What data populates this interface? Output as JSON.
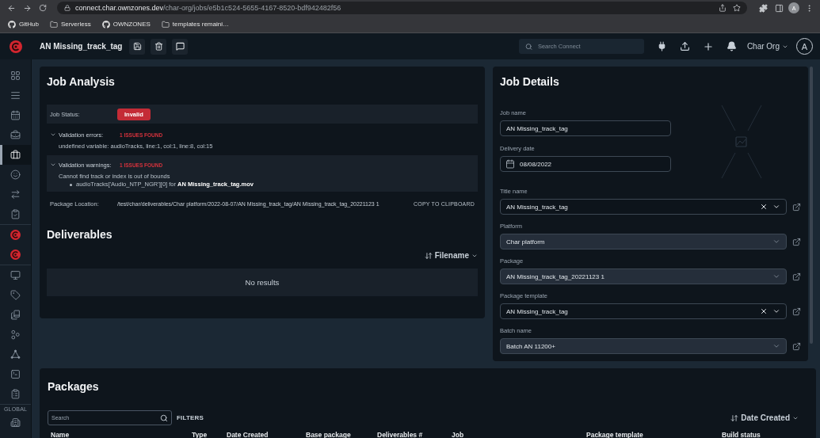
{
  "browser": {
    "url_host": "connect.char.ownzones.dev",
    "url_path": "/char-org/jobs/e5b1c524-5655-4167-8520-bdf942482f56",
    "profile": "A",
    "bookmarks": [
      {
        "label": "GitHub",
        "kind": "repo"
      },
      {
        "label": "Serverless",
        "kind": "folder"
      },
      {
        "label": "OWNZONES",
        "kind": "repo"
      },
      {
        "label": "templates remaini…",
        "kind": "folder"
      }
    ]
  },
  "header": {
    "title": "AN Missing_track_tag",
    "search_placeholder": "Search Connect",
    "org": "Char Org",
    "avatar": "A"
  },
  "sidebar": {
    "groups": [
      {
        "items": [
          {
            "selected": false
          },
          {
            "selected": false
          },
          {
            "selected": false
          },
          {
            "selected": false
          },
          {
            "selected": true
          },
          {
            "selected": false
          },
          {
            "selected": false
          },
          {
            "selected": false
          }
        ]
      },
      {
        "items": [
          {
            "selected": false
          },
          {
            "selected": false
          }
        ]
      },
      {
        "items": [
          {
            "selected": false
          },
          {
            "selected": false
          },
          {
            "selected": false
          },
          {
            "selected": false
          },
          {
            "selected": false
          },
          {
            "selected": false
          },
          {
            "selected": false
          }
        ]
      },
      {
        "label": "GLOBAL",
        "items": [
          {
            "selected": false
          }
        ]
      }
    ]
  },
  "job_analysis": {
    "title": "Job Analysis",
    "status_label": "Job Status:",
    "status": "Invalid",
    "validations": [
      {
        "label": "Validation errors:",
        "count": "1 ISSUES FOUND",
        "expanded": true,
        "message": "undefined variable: audioTracks, line:1, col:1, line:8, col:15"
      },
      {
        "label": "Validation warnings:",
        "count": "1 ISSUES FOUND",
        "expanded": true,
        "message": "Cannot find track or index is out of bounds",
        "details": [
          "audioTracks['Audio_NTP_NGR'][0] for **AN Missing_track_tag.mov**"
        ]
      }
    ],
    "package_location": {
      "label": "Package Location:",
      "value": "/test/char/deliverables/Char platform/2022-08-07/AN Missing_track_tag/AN Missing_track_tag_20221123 1",
      "action": "COPY TO CLIPBOARD"
    }
  },
  "deliverables": {
    "title": "Deliverables",
    "sort": "Filename",
    "empty": "No results"
  },
  "job_details": {
    "title": "Job Details",
    "fields": [
      {
        "label": "Job name",
        "kind": "text",
        "value": "AN Missing_track_tag",
        "disabled": false,
        "clearable": false
      },
      {
        "label": "Delivery date",
        "kind": "date",
        "value": "08/08/2022",
        "disabled": false,
        "clearable": false
      },
      {
        "label": "Title name",
        "kind": "select",
        "value": "AN Missing_track_tag",
        "disabled": false,
        "clearable": true
      },
      {
        "label": "Platform",
        "kind": "select",
        "value": "Char platform",
        "disabled": true,
        "clearable": false
      },
      {
        "label": "Package",
        "kind": "select",
        "value": "AN Missing_track_tag_20221123 1",
        "disabled": true,
        "clearable": false
      },
      {
        "label": "Package template",
        "kind": "select",
        "value": "AN Missing_track_tag",
        "disabled": false,
        "clearable": true
      },
      {
        "label": "Batch name",
        "kind": "select",
        "value": "Batch AN 11200+",
        "disabled": true,
        "clearable": false
      }
    ]
  },
  "packages": {
    "title": "Packages",
    "search_placeholder": "Search",
    "filters": "FILTERS",
    "sort": "Date Created",
    "columns": [
      "Name",
      "Type",
      "Date Created",
      "Base package",
      "Deliverables #",
      "Job",
      "Package template",
      "Build status"
    ]
  }
}
